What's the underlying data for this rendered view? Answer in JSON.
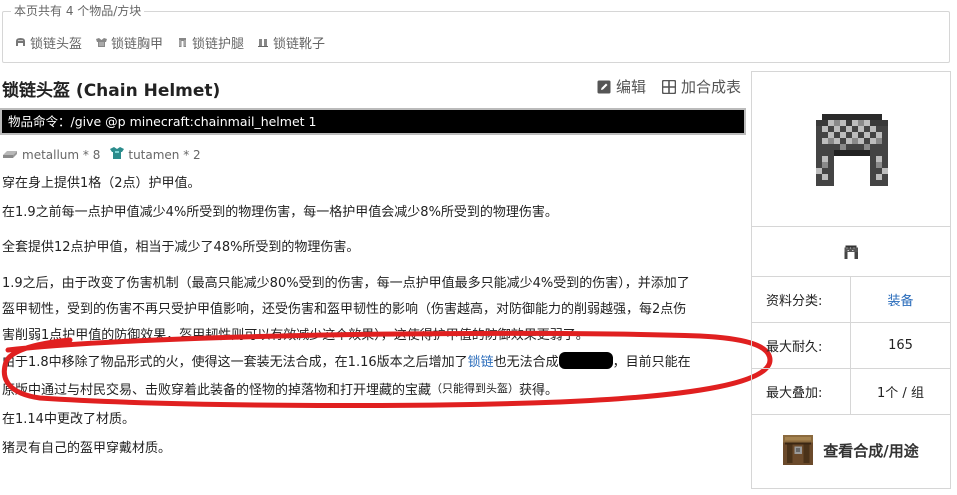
{
  "set": {
    "legend": "本页共有 4 个物品/方块",
    "items": [
      {
        "label": "锁链头盔",
        "icon": "helmet-icon"
      },
      {
        "label": "锁链胸甲",
        "icon": "chestplate-icon"
      },
      {
        "label": "锁链护腿",
        "icon": "leggings-icon"
      },
      {
        "label": "锁链靴子",
        "icon": "boots-icon"
      }
    ]
  },
  "title": "锁链头盔 (Chain Helmet)",
  "actions": {
    "edit": "编辑",
    "add_recipe": "加合成表"
  },
  "command": "物品命令：/give @p minecraft:chainmail_helmet 1",
  "materials": [
    {
      "label": "metallum * 8",
      "icon": "metallum-icon"
    },
    {
      "label": "tutamen * 2",
      "icon": "tutamen-icon"
    }
  ],
  "paragraphs": {
    "p1": "穿在身上提供1格（2点）护甲值。",
    "p2": "在1.9之前每一点护甲值减少4%所受到的物理伤害，每一格护甲值会减少8%所受到的物理伤害。",
    "p3": "全套提供12点护甲值，相当于减少了48%所受到的物理伤害。",
    "p4_line1": "1.9之后，由于改变了伤害机制（最高只能减少80%受到的伤害，每一点护甲值最多只能减少4%受到的伤害），并添加了",
    "p4_line2": "盔甲韧性，受到的伤害不再只受护甲值影响，还受伤害和盔甲韧性的影响（伤害越高，对防御能力的削弱越强，每2点伤",
    "p4_line3": "害削弱1点护甲值的防御效果，盔甲韧性则可以有效减少这个效果），这使得护甲值的防御效果更弱了。",
    "p5_part1": "由于1.8中移除了物品形式的火，使得这一套装无法合成，在1.16版本之后增加了",
    "p5_link": "锁链",
    "p5_part2": "也无法合成",
    "p5_part3": "，目前只能在",
    "p5_line2a": "原版中通过与村民交易、击败穿着此装备的怪物的掉落物和打开埋藏的宝藏",
    "p5_line2_small": "（只能得到头盔）",
    "p5_line2b": "获得。",
    "p6": "在1.14中更改了材质。",
    "p7": "猪灵有自己的盔甲穿戴材质。"
  },
  "panel": {
    "rows": [
      {
        "key": "资料分类:",
        "value": "装备",
        "link": true
      },
      {
        "key": "最大耐久:",
        "value": "165",
        "link": false
      },
      {
        "key": "最大叠加:",
        "value": "1个 / 组",
        "link": false
      }
    ],
    "recipe_label": "查看合成/用途"
  },
  "colors": {
    "link": "#2a6cbb",
    "annotation": "#e02020",
    "command_bg": "#000000"
  }
}
